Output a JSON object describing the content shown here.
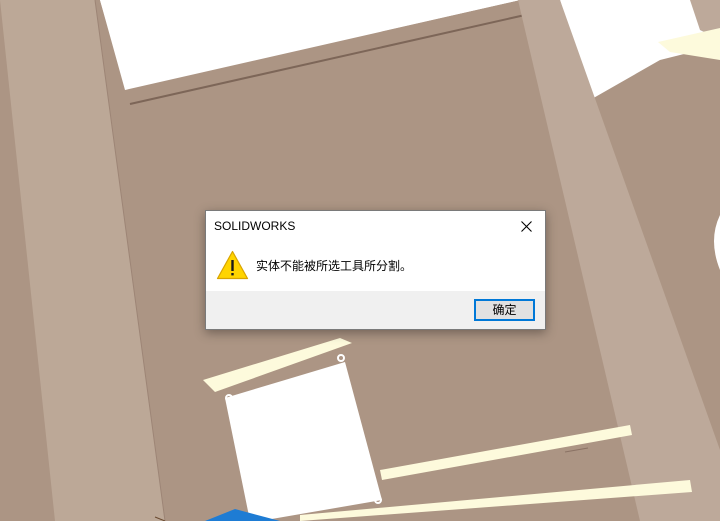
{
  "viewport": {
    "model_colors": {
      "face": "#ac9584",
      "face_light": "#bda99a",
      "edge_dark": "#8a7264",
      "highlight": "#fdfadc",
      "background": "#ffffff",
      "selection_blue": "#1e7cd4"
    }
  },
  "dialog": {
    "title": "SOLIDWORKS",
    "message": "实体不能被所选工具所分割。",
    "ok_label": "确定",
    "icon": "warning-icon",
    "close_icon": "close-icon"
  }
}
